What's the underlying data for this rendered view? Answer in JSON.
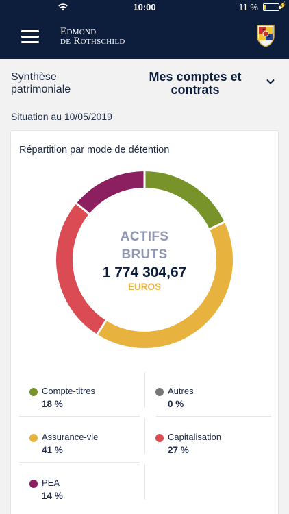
{
  "status_bar": {
    "time": "10:00",
    "battery_percent": "11 %",
    "battery_level": 0.11
  },
  "header": {
    "brand_line1": "Edmond",
    "brand_line2": "de Rothschild"
  },
  "account_bar": {
    "section_label": "Synthèse patrimoniale",
    "selected_account": "Mes comptes et contrats",
    "date_text": "Situation au 10/05/2019"
  },
  "card": {
    "title": "Répartition par mode de détention",
    "center_label_line1": "ACTIFS",
    "center_label_line2": "BRUTS",
    "total_value": "1 774 304,67",
    "currency": "EUROS"
  },
  "colors": {
    "compte_titres": "#77932a",
    "assurance_vie": "#e8b23e",
    "capitalisation": "#da4b53",
    "pea": "#8c1f5f",
    "autres": "#757575"
  },
  "legend": [
    {
      "name": "Compte-titres",
      "pct": "18 %",
      "color": "#77932a"
    },
    {
      "name": "Autres",
      "pct": "0 %",
      "color": "#757575"
    },
    {
      "name": "Assurance-vie",
      "pct": "41 %",
      "color": "#e8b23e"
    },
    {
      "name": "Capitalisation",
      "pct": "27 %",
      "color": "#da4b53"
    },
    {
      "name": "PEA",
      "pct": "14 %",
      "color": "#8c1f5f"
    }
  ],
  "chart_data": {
    "type": "pie",
    "title": "Répartition par mode de détention",
    "categories": [
      "Compte-titres",
      "Assurance-vie",
      "Capitalisation",
      "PEA",
      "Autres"
    ],
    "values": [
      18,
      41,
      27,
      14,
      0
    ],
    "colors": [
      "#77932a",
      "#e8b23e",
      "#da4b53",
      "#8c1f5f",
      "#757575"
    ]
  }
}
